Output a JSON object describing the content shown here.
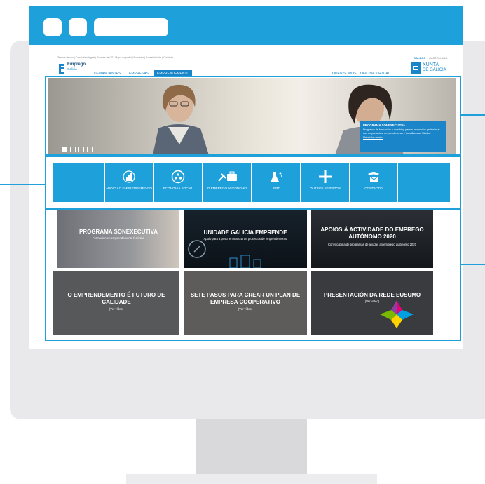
{
  "top_bar": {
    "links": "Termos de uso | Condicións legais | Enlaces de OS | Mapa do portal | Buscador | Accesibilidade | Contacto",
    "lang_gl": "GALEGO",
    "lang_es": "CASTELLANO"
  },
  "logo": {
    "line1": "Emprego",
    "line2": "Galicia"
  },
  "nav": {
    "demandantes": "DEMANDANTES",
    "empresas": "EMPRESAS",
    "emprendemento": "EMPRENDEMENTO",
    "quen_somos": "QUEN SOMOS",
    "oficina": "OFICINA VIRTUAL"
  },
  "xunta": {
    "line1": "XUNTA",
    "line2": "DE GALICIA"
  },
  "hero": {
    "title": "PROGRAMA SONEXECUTIVA",
    "desc": "Programa de formación e coaching para a promoción profesional das empresarias, emprendedoras e traballadoras fillados.",
    "link": "Máis información"
  },
  "tiles": [
    {
      "label": "APOIO AO EMPRENDEMENTO",
      "icon": "chart-globe-icon"
    },
    {
      "label": "ECONOMÍA SOCIAL",
      "icon": "people-circle-icon"
    },
    {
      "label": "O EMPREGO AUTÓNOMO",
      "icon": "tools-briefcase-icon"
    },
    {
      "label": "IERT",
      "icon": "flask-icon"
    },
    {
      "label": "OUTROS SERVIZOS",
      "icon": "plus-icon"
    },
    {
      "label": "CONTACTO",
      "icon": "phone-mail-icon"
    }
  ],
  "cards": [
    {
      "title": "PROGRAMA SONEXECUTIVA",
      "sub": "Formación en emprendemento feminino"
    },
    {
      "title": "UNIDADE GALICIA EMPRENDE",
      "sub": "Apoio para a posta en marcha de proxectos de emprendemento"
    },
    {
      "title": "APOIOS Á ACTIVIDADE DO EMPREGO AUTÓNOMO 2020",
      "sub": "Convocatoria de programas de axudas ao emprego autónomo 2020"
    },
    {
      "title": "O EMPRENDEMENTO É FUTURO DE CALIDADE",
      "sub": "(Ver vídeo)"
    },
    {
      "title": "SETE PASOS PARA CREAR UN PLAN DE EMPRESA COOPERATIVO",
      "sub": "(Ver vídeo)"
    },
    {
      "title": "PRESENTACIÓN DA REDE EUSUMO",
      "sub": "(Ver vídeo)"
    }
  ],
  "colors": {
    "accent": "#1ea0da",
    "nav_blue": "#1a86c9",
    "monitor": "#e9e9eb"
  }
}
